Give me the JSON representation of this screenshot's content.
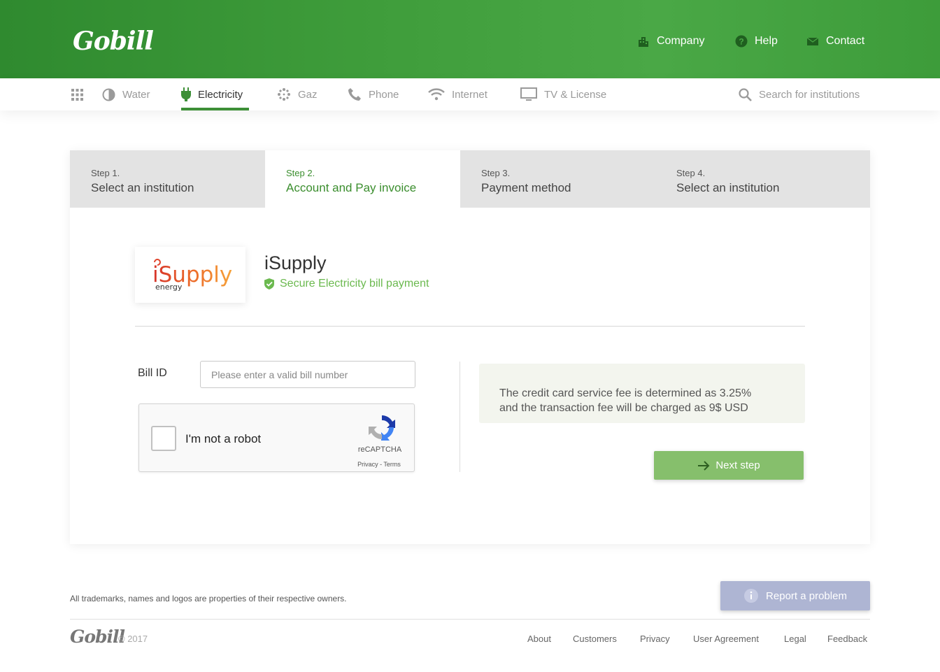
{
  "header": {
    "logo": "Gobill",
    "nav": [
      {
        "label": "Company",
        "icon": "building-icon"
      },
      {
        "label": "Help",
        "icon": "help-circle-icon"
      },
      {
        "label": "Contact",
        "icon": "mail-icon"
      }
    ]
  },
  "subnav": {
    "items": [
      {
        "label": "Water",
        "icon": "water-drop-icon"
      },
      {
        "label": "Electricity",
        "icon": "plug-icon",
        "active": true
      },
      {
        "label": "Gaz",
        "icon": "gas-dots-icon"
      },
      {
        "label": "Phone",
        "icon": "phone-icon"
      },
      {
        "label": "Internet",
        "icon": "wifi-icon"
      },
      {
        "label": "TV & License",
        "icon": "monitor-icon"
      }
    ],
    "search_placeholder": "Search for institutions"
  },
  "steps": [
    {
      "number": "Step 1.",
      "title": "Select an institution"
    },
    {
      "number": "Step 2.",
      "title": "Account and Pay invoice",
      "active": true
    },
    {
      "number": "Step 3.",
      "title": "Payment method"
    },
    {
      "number": "Step 4.",
      "title": "Select an institution"
    }
  ],
  "institution": {
    "logo_text": "iSupply",
    "logo_sub": "energy",
    "name": "iSupply",
    "secure_text": "Secure Electricity bill  payment"
  },
  "form": {
    "bill_label": "Bill ID",
    "bill_placeholder": "Please enter a valid bill number",
    "captcha_label": "I'm not a robot",
    "captcha_brand": "reCAPTCHA",
    "captcha_terms": "Privacy - Terms"
  },
  "fee_info": {
    "line1": "The credit card service fee is determined as 3.25%",
    "line2": "and the transaction fee will be charged as 9$ USD"
  },
  "next_button": "Next step",
  "footer": {
    "trademark": "All trademarks, names and logos are properties of their respective owners.",
    "report_button": "Report a problem",
    "logo": "Gobill",
    "copyright": "© 2017",
    "links": [
      "About",
      "Customers",
      "Privacy",
      "User Agreement",
      "Legal",
      "Feedback"
    ]
  },
  "colors": {
    "brand_green": "#3f9d3b",
    "step_active": "#3b8e2e",
    "secure_green": "#6bb94f",
    "next_button": "#86bf6c",
    "report_button": "#aeb5d3"
  }
}
